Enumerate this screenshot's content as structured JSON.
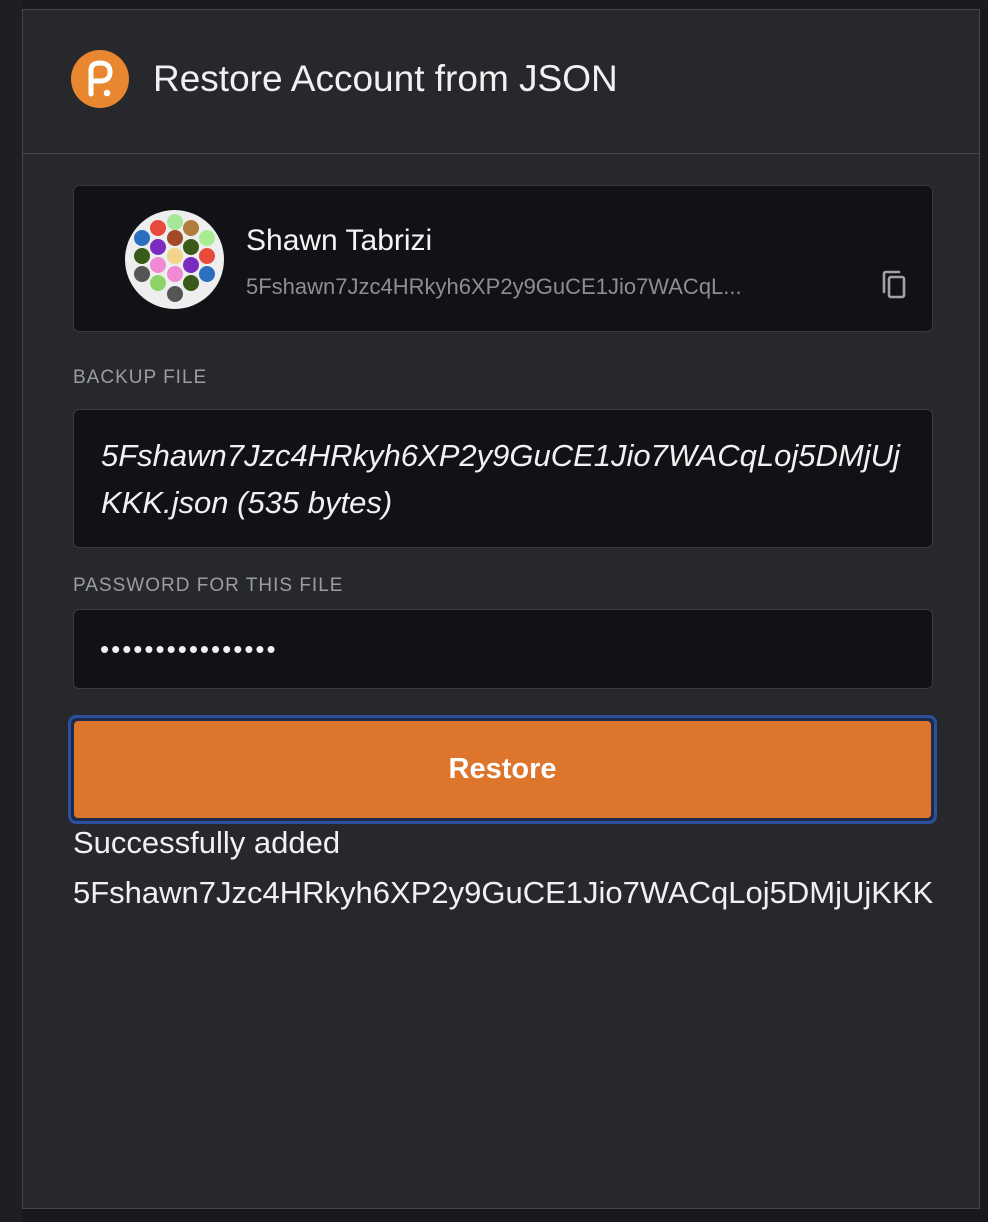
{
  "header": {
    "title": "Restore Account from JSON",
    "logo_icon": "polkadot-logo-icon",
    "logo_color": "#e8872f"
  },
  "account": {
    "name": "Shawn Tabrizi",
    "address_truncated": "5Fshawn7Jzc4HRkyh6XP2y9GuCE1Jio7WACqL...",
    "identicon": "identicon-icon",
    "copy_icon": "copy-icon"
  },
  "backup": {
    "label": "BACKUP FILE",
    "file_text": "5Fshawn7Jzc4HRkyh6XP2y9GuCE1Jio7WACqLoj5DMjUjKKK.json (535 bytes)"
  },
  "password": {
    "label": "PASSWORD FOR THIS FILE",
    "value": "••••••••••••••••"
  },
  "restore": {
    "label": "Restore",
    "accent": "#dd752d",
    "focus_ring": "#2c4f9e"
  },
  "status": {
    "message": "Successfully added 5Fshawn7Jzc4HRkyh6XP2y9GuCE1Jio7WACqLoj5DMjUjKKK"
  }
}
